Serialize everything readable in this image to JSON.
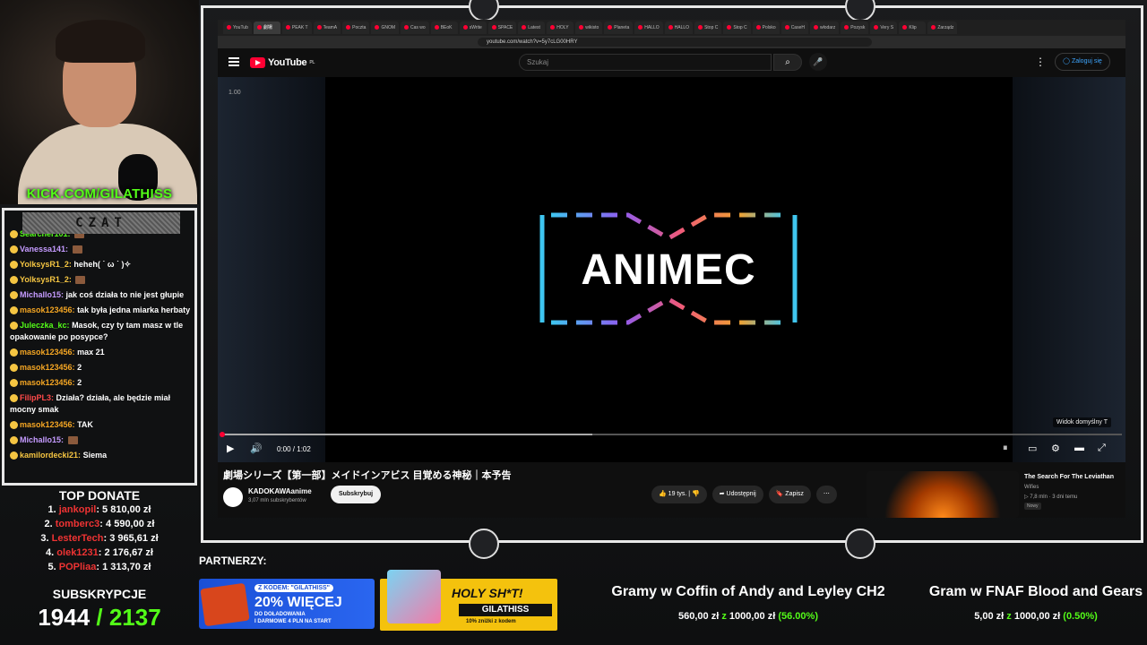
{
  "overlay": {
    "kick_prefix": "KICK.COM/",
    "kick_name": "GILATHISS",
    "chat_title": "CZAT",
    "chat_messages": [
      {
        "user": "Searcher101:",
        "text": "",
        "color": "#53fc18"
      },
      {
        "user": "Vanessa141:",
        "text": "",
        "color": "#c59bff"
      },
      {
        "user": "YolksysR1_2:",
        "text": "heheh( ˙ ω ˙ )✧",
        "color": "#f5c542"
      },
      {
        "user": "YolksysR1_2:",
        "text": "",
        "color": "#f5c542"
      },
      {
        "user": "Michallo15:",
        "text": "jak coś działa to nie jest głupie",
        "color": "#c59bff"
      },
      {
        "user": "masok123456:",
        "text": "tak była jedna miarka herbaty",
        "color": "#f5a623"
      },
      {
        "user": "Juleczka_kc:",
        "text": "Masok, czy ty tam masz w tle opakowanie po posypce?",
        "color": "#53fc18"
      },
      {
        "user": "masok123456:",
        "text": "max 21",
        "color": "#f5a623"
      },
      {
        "user": "masok123456:",
        "text": "2",
        "color": "#f5a623"
      },
      {
        "user": "masok123456:",
        "text": "2",
        "color": "#f5a623"
      },
      {
        "user": "FilipPL3:",
        "text": "Działa? działa, ale będzie miał mocny smak",
        "color": "#ff4a4a"
      },
      {
        "user": "masok123456:",
        "text": "TAK",
        "color": "#f5a623"
      },
      {
        "user": "Michallo15:",
        "text": "",
        "color": "#c59bff"
      },
      {
        "user": "kamilordecki21:",
        "text": "Siema",
        "color": "#f5c542"
      }
    ],
    "top_donate_title": "TOP DONATE",
    "donates": [
      {
        "n": "1.",
        "name": "jankopil",
        "amount": "5 810,00 zł"
      },
      {
        "n": "2.",
        "name": "tomberc3",
        "amount": "4 590,00 zł"
      },
      {
        "n": "3.",
        "name": "LesterTech",
        "amount": "3 965,61 zł"
      },
      {
        "n": "4.",
        "name": "olek1231",
        "amount": "2 176,67 zł"
      },
      {
        "n": "5.",
        "name": "POPliaa",
        "amount": "1 313,70 zł"
      }
    ],
    "subs_title": "SUBSKRYPCJE",
    "subs_current": "1944",
    "subs_goal": "/ 2137",
    "partners_label": "PARTNERZY:",
    "banner1": {
      "code": "Z KODEM: \"GILATHISS\"",
      "big": "20% WIĘCEJ",
      "line1": "DO DOŁADOWANIA",
      "line2": "I DARMOWE 4 PLN NA START"
    },
    "banner2": {
      "head": "HOLY SH*T!",
      "code": "GILATHISS",
      "small": "10% zniżki z kodem"
    },
    "goals": [
      {
        "title": "Gramy w Coffin of Andy and Leyley CH2",
        "current": "560,00 zł",
        "sep": "z",
        "target": "1000,00 zł",
        "percent": "(56.00%)"
      },
      {
        "title": "Gram w FNAF Blood and Gears",
        "current": "5,00 zł",
        "sep": "z",
        "target": "1000,00 zł",
        "percent": "(0.50%)"
      }
    ]
  },
  "browser": {
    "tabs": [
      "YouTub",
      "劇場",
      "PEAK T",
      "TeamA",
      "Poczta",
      "GNOM",
      "Cas wo",
      "BEoK",
      "sWrite",
      "SPACE",
      "Latest",
      "HOLY",
      "wikisto",
      "Planeta",
      "HALLO",
      "HALLO",
      "Stop C",
      "Stop C",
      "Polsko",
      "CaseH",
      "włodarz",
      "Pozysk",
      "Very S",
      "Klip",
      "Zarządz"
    ],
    "url": "youtube.com/watch?v=5y7cLG00HRY"
  },
  "youtube": {
    "logo": "YouTube",
    "logo_region": "PL",
    "search_placeholder": "Szukaj",
    "login": "Zaloguj się",
    "speed": "1.00",
    "video_logo_text": "ANIMEC",
    "default_view": "Widok domyślny",
    "default_view_key": "T",
    "time": "0:00 / 1:02",
    "video_title": "劇場シリーズ【第一部】メイドインアビス 目覚める神秘｜本予告",
    "channel_name": "KADOKAWAanime",
    "channel_subs": "3,07 mln subskrybentów",
    "subscribe": "Subskrybuj",
    "likes": "19 tys.",
    "share": "Udostępnij",
    "save": "Zapisz",
    "rec_title": "The Search For The Leviathan",
    "rec_channel": "Wifies",
    "rec_meta": "▷ 7,8 mln · 3 dni temu",
    "rec_badge": "Nowy"
  }
}
